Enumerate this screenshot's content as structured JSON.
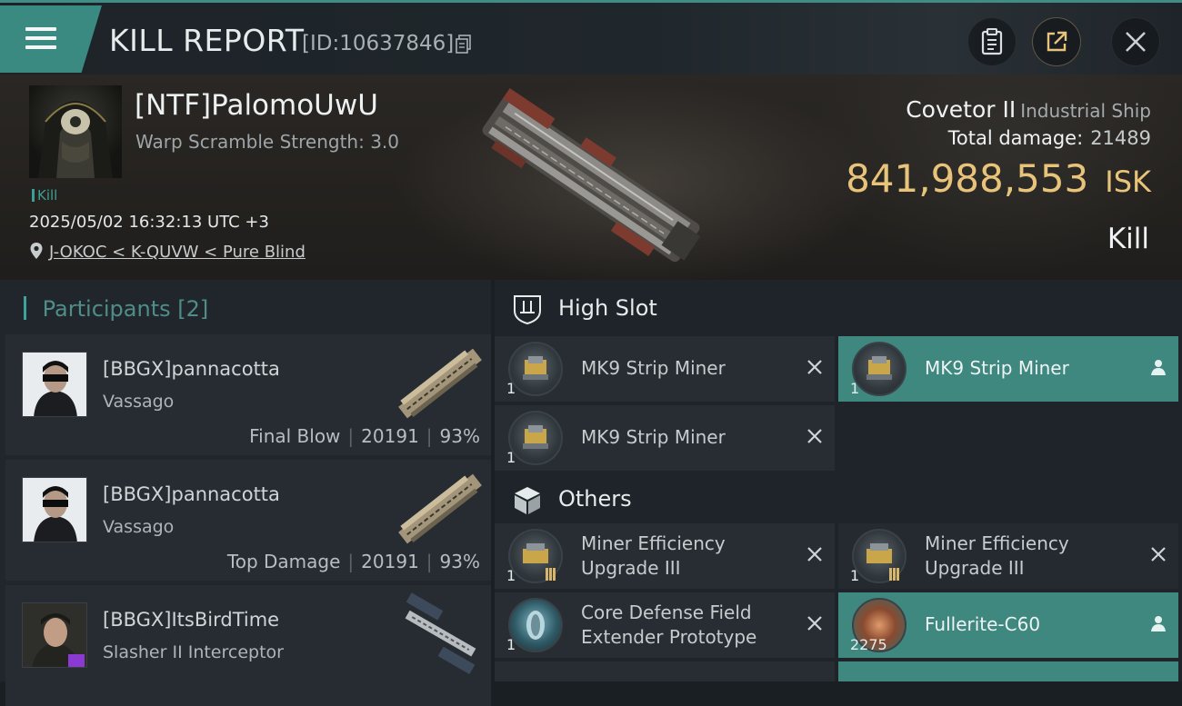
{
  "header": {
    "title": "KILL REPORT",
    "report_id": "[ID:10637846]"
  },
  "victim": {
    "name": "[NTF]PalomoUwU",
    "warp_scramble": "Warp Scramble Strength: 3.0",
    "tag": "Kill",
    "timestamp": "2025/05/02 16:32:13 UTC +3",
    "location": "J-OKOC < K-QUVW < Pure Blind",
    "ship_name": "Covetor II",
    "ship_class": "Industrial Ship",
    "total_damage_label": "Total damage:",
    "total_damage": "21489",
    "isk_value": "841,988,553",
    "isk_unit": "ISK",
    "result": "Kill"
  },
  "participants": {
    "label": "Participants",
    "count": "[2]",
    "items": [
      {
        "name": "[BBGX]pannacotta",
        "ship": "Vassago",
        "role": "Final Blow",
        "damage": "20191",
        "percent": "93%"
      },
      {
        "name": "[BBGX]pannacotta",
        "ship": "Vassago",
        "role": "Top Damage",
        "damage": "20191",
        "percent": "93%"
      },
      {
        "name": "[BBGX]ItsBirdTime",
        "ship": "Slasher II Interceptor",
        "role": "",
        "damage": "",
        "percent": ""
      }
    ]
  },
  "fitting": {
    "high_slot": {
      "label": "High Slot",
      "items": [
        {
          "name": "MK9 Strip Miner",
          "qty": "1",
          "status": "destroyed"
        },
        {
          "name": "MK9 Strip Miner",
          "qty": "1",
          "status": "dropped"
        },
        {
          "name": "MK9 Strip Miner",
          "qty": "1",
          "status": "destroyed"
        }
      ]
    },
    "others": {
      "label": "Others",
      "items": [
        {
          "name_line1": "Miner Efficiency",
          "name_line2": "Upgrade III",
          "qty": "1",
          "status": "destroyed"
        },
        {
          "name_line1": "Miner Efficiency",
          "name_line2": "Upgrade III",
          "qty": "1",
          "status": "destroyed"
        },
        {
          "name_line1": "Core Defense Field",
          "name_line2": "Extender Prototype",
          "qty": "1",
          "status": "destroyed"
        },
        {
          "name_line1": "Fullerite-C60",
          "name_line2": "",
          "qty": "2275",
          "status": "dropped"
        }
      ]
    }
  },
  "colors": {
    "accent": "#3f8d86",
    "isk": "#e8c47a",
    "selected": "#3f8880"
  }
}
